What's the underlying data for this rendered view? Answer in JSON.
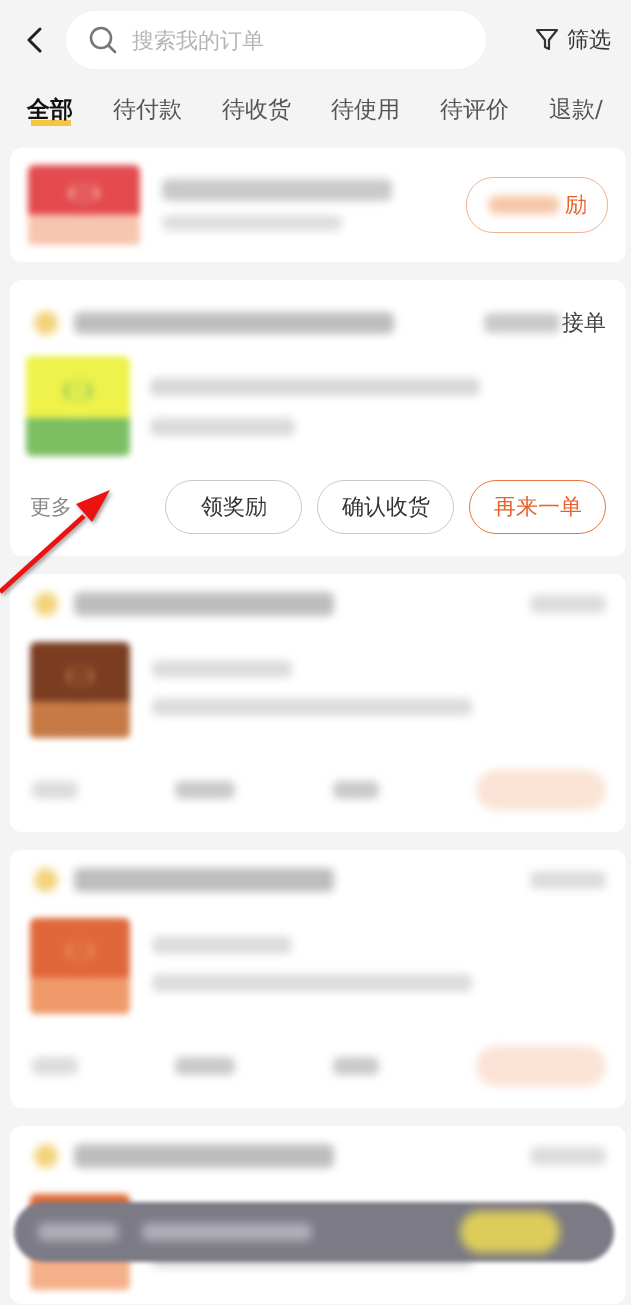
{
  "header": {
    "search": {
      "placeholder": "搜索我的订单"
    },
    "filter": "筛选"
  },
  "tabs": [
    {
      "label": "全部",
      "selected": true
    },
    {
      "label": "待付款",
      "selected": false
    },
    {
      "label": "待收货",
      "selected": false
    },
    {
      "label": "待使用",
      "selected": false
    },
    {
      "label": "待评价",
      "selected": false
    },
    {
      "label": "退款/",
      "selected": false
    }
  ],
  "orders": [
    {
      "kind": "partial",
      "action": "励"
    },
    {
      "kind": "detailed",
      "status": "接单",
      "more": "更多",
      "actions": [
        {
          "label": "领奖励",
          "primary": false
        },
        {
          "label": "确认收货",
          "primary": false
        },
        {
          "label": "再来一单",
          "primary": true
        }
      ]
    },
    {
      "kind": "blurred"
    },
    {
      "kind": "blurred"
    },
    {
      "kind": "blurred_cut"
    }
  ]
}
